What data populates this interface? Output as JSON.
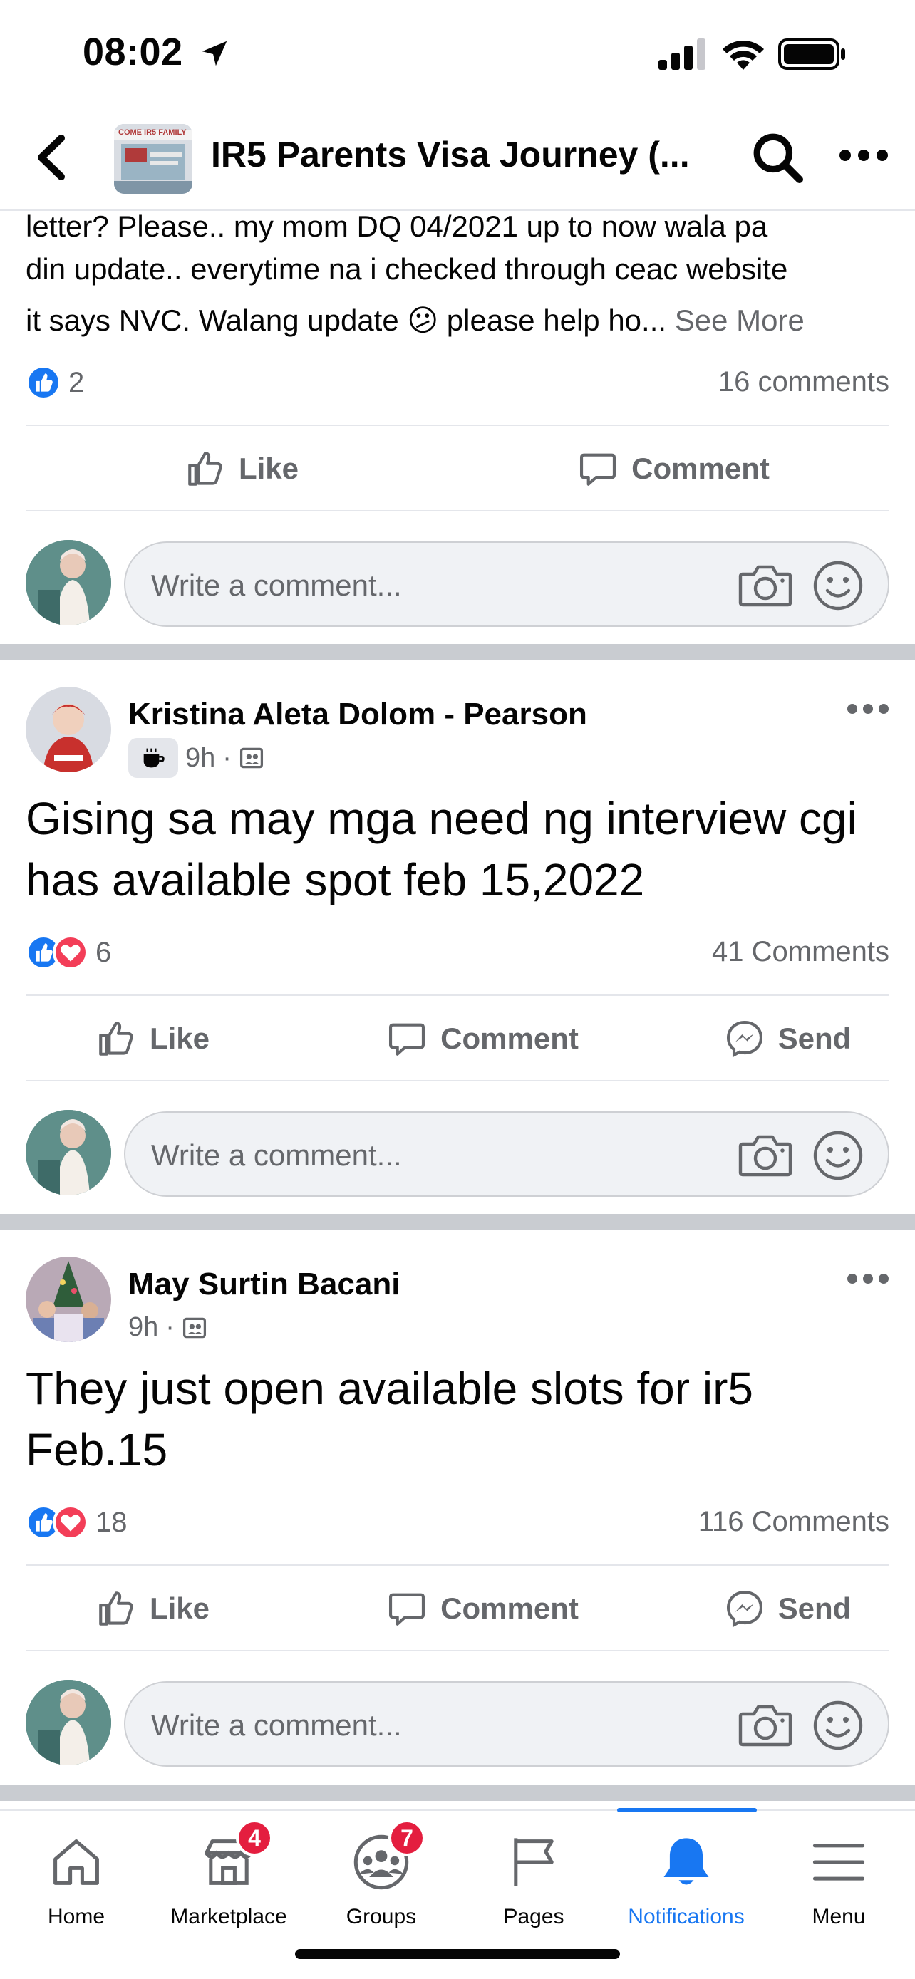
{
  "status_bar": {
    "time": "08:02"
  },
  "header": {
    "group_title": "IR5 Parents Visa Journey (...",
    "thumb_text": "COME IR5 FAMILY"
  },
  "post0": {
    "text_lines": [
      "letter?  Please.. my mom DQ 04/2021 up to now wala pa",
      "din update.. everytime na i checked through ceac website",
      "it says NVC. Walang update 😕 please help ho..."
    ],
    "see_more": "See More",
    "reaction_count": "2",
    "comments": "16 comments",
    "like_label": "Like",
    "comment_label": "Comment",
    "comment_placeholder": "Write a comment..."
  },
  "post1": {
    "author": "Kristina Aleta Dolom - Pearson",
    "time": "9h",
    "dot": "·",
    "text": "Gising sa may mga need ng interview cgi has available spot feb 15,2022",
    "reaction_count": "6",
    "comments": "41 Comments",
    "like_label": "Like",
    "comment_label": "Comment",
    "send_label": "Send",
    "comment_placeholder": "Write a comment..."
  },
  "post2": {
    "author": "May Surtin Bacani",
    "time": "9h",
    "dot": "·",
    "text": "They just open available slots for ir5 Feb.15",
    "reaction_count": "18",
    "comments": "116 Comments",
    "like_label": "Like",
    "comment_label": "Comment",
    "send_label": "Send",
    "comment_placeholder": "Write a comment..."
  },
  "nav": {
    "items": [
      {
        "label": "Home",
        "icon": "home-icon"
      },
      {
        "label": "Marketplace",
        "icon": "marketplace-icon",
        "badge": "4"
      },
      {
        "label": "Groups",
        "icon": "groups-icon",
        "badge": "7"
      },
      {
        "label": "Pages",
        "icon": "pages-flag-icon"
      },
      {
        "label": "Notifications",
        "icon": "bell-icon",
        "active": true
      },
      {
        "label": "Menu",
        "icon": "hamburger-menu-icon"
      }
    ]
  },
  "colors": {
    "accent": "#1877f2",
    "secondary_text": "#65676b",
    "badge": "#e41e3f",
    "love": "#f33e58"
  }
}
